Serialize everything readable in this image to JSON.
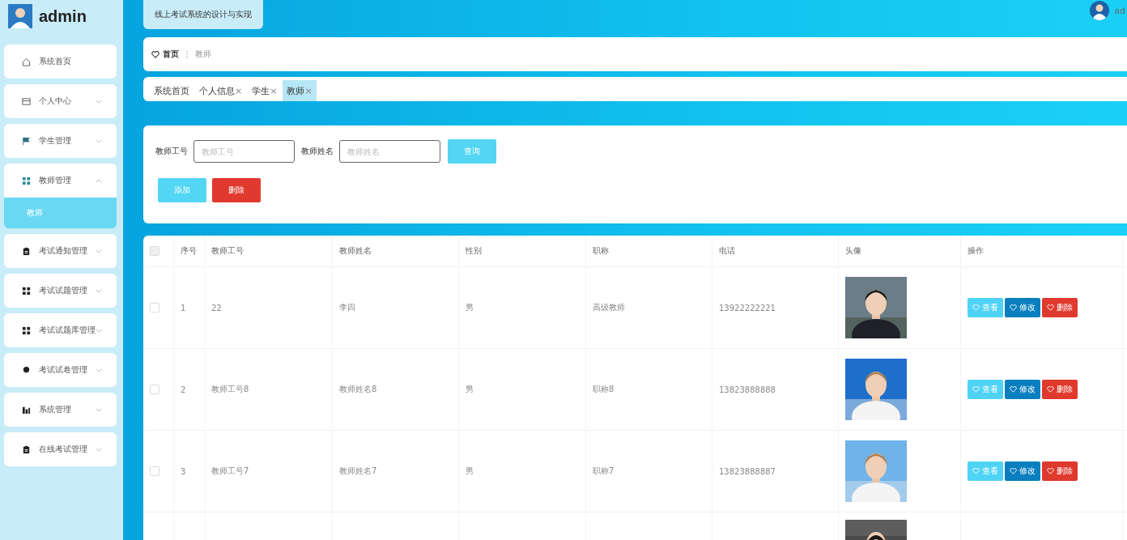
{
  "sidebar": {
    "username": "admin",
    "items": [
      {
        "label": "系统首页",
        "kind": "link",
        "expanded": false
      },
      {
        "label": "个人中心",
        "kind": "submenu",
        "expanded": false
      },
      {
        "label": "学生管理",
        "kind": "submenu",
        "expanded": false
      },
      {
        "label": "教师管理",
        "kind": "submenu",
        "expanded": true,
        "children": [
          {
            "label": "教师",
            "selected": true
          }
        ]
      },
      {
        "label": "考试通知管理",
        "kind": "submenu",
        "expanded": false
      },
      {
        "label": "考试试题管理",
        "kind": "submenu",
        "expanded": false
      },
      {
        "label": "考试试题库管理",
        "kind": "submenu",
        "expanded": false
      },
      {
        "label": "考试试卷管理",
        "kind": "submenu",
        "expanded": false
      },
      {
        "label": "系统管理",
        "kind": "submenu",
        "expanded": false
      },
      {
        "label": "在线考试管理",
        "kind": "submenu",
        "expanded": false
      }
    ]
  },
  "header": {
    "title": "线上考试系统的设计与实现",
    "user": "ad"
  },
  "breadcrumb": [
    "首页",
    "教师"
  ],
  "tabs": [
    {
      "label": "系统首页",
      "selected": false
    },
    {
      "label": "个人信息",
      "close": "×",
      "selected": false
    },
    {
      "label": "学生",
      "close": "×",
      "selected": false
    },
    {
      "label": "教师",
      "close": "×",
      "selected": true
    }
  ],
  "search": {
    "fields": [
      {
        "label": "教师工号",
        "placeholder": "教师工号"
      },
      {
        "label": "教师姓名",
        "placeholder": "教师姓名"
      }
    ],
    "query_button": "查询",
    "add_button": "添加",
    "delete_button": "删除"
  },
  "table": {
    "columns": [
      "序号",
      "教师工号",
      "教师姓名",
      "性别",
      "职称",
      "电话",
      "头像",
      "操作"
    ],
    "all_checked": false,
    "rows": [
      {
        "checked": false,
        "cells": [
          "1",
          "22",
          "李四",
          "男",
          "高级教师",
          "13922222221"
        ],
        "actions": [
          {
            "kind": "view",
            "label": "查看"
          },
          {
            "kind": "edit",
            "label": "修改"
          },
          {
            "kind": "delete",
            "label": "删除"
          }
        ]
      },
      {
        "checked": false,
        "cells": [
          "2",
          "教师工号8",
          "教师姓名8",
          "男",
          "职称8",
          "13823888888"
        ],
        "actions": [
          {
            "kind": "view",
            "label": "查看"
          },
          {
            "kind": "edit",
            "label": "修改"
          },
          {
            "kind": "delete",
            "label": "删除"
          }
        ]
      },
      {
        "checked": false,
        "cells": [
          "3",
          "教师工号7",
          "教师姓名7",
          "男",
          "职称7",
          "13823888887"
        ],
        "actions": [
          {
            "kind": "view",
            "label": "查看"
          },
          {
            "kind": "edit",
            "label": "修改"
          },
          {
            "kind": "delete",
            "label": "删除"
          }
        ]
      }
    ]
  }
}
